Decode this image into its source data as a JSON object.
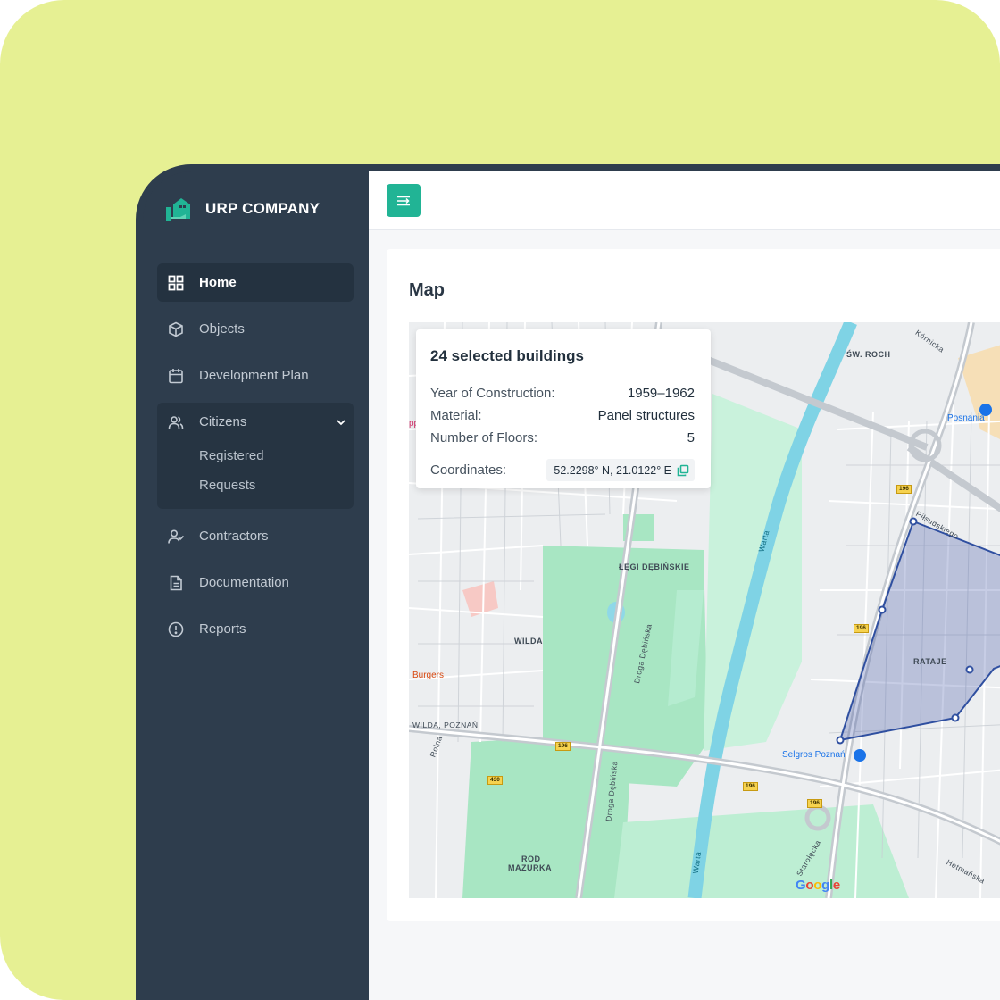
{
  "brand": {
    "name": "URP COMPANY",
    "icon": "house-hand-icon",
    "accent": "#21b495"
  },
  "sidebar": {
    "items": [
      {
        "label": "Home",
        "icon": "grid-icon",
        "active": true
      },
      {
        "label": "Objects",
        "icon": "cube-icon"
      },
      {
        "label": "Development Plan",
        "icon": "calendar-icon"
      },
      {
        "label": "Citizens",
        "icon": "users-icon",
        "expanded": true,
        "children": [
          "Registered",
          "Requests"
        ]
      },
      {
        "label": "Contractors",
        "icon": "user-check-icon"
      },
      {
        "label": "Documentation",
        "icon": "document-icon"
      },
      {
        "label": "Reports",
        "icon": "alert-circle-icon"
      }
    ]
  },
  "topbar": {
    "menu_icon": "menu-collapse-icon"
  },
  "page": {
    "title": "Map"
  },
  "popup": {
    "title": "24 selected buildings",
    "rows": [
      {
        "label": "Year of Construction:",
        "value": "1959–1962"
      },
      {
        "label": "Material:",
        "value": "Panel structures"
      },
      {
        "label": "Number of Floors:",
        "value": "5"
      }
    ],
    "coordinates_label": "Coordinates:",
    "coordinates_value": "52.2298° N, 21.0122° E"
  },
  "map": {
    "labels": {
      "sw_roch": "ŚW. ROCH",
      "legi": "ŁĘGI DĘBIŃSKIE",
      "wilda": "WILDA",
      "rataje": "RATAJE",
      "wilda_poznan": "WILDA, POZNAŃ",
      "rod": "ROD",
      "mazurka": "MAZURKA",
      "warta1": "Warta",
      "warta2": "Warta",
      "droga1": "Droga Dębińska",
      "droga2": "Droga Dębińska",
      "rolna": "Rolna",
      "pilsudskiego": "Piłsudskiego",
      "hetmanska": "Hetmańska",
      "starolecka": "Starołęcka",
      "kornicka": "Kórnicka"
    },
    "pois": {
      "posnania": "Posnania",
      "selgros": "Selgros Poznań",
      "burgers": "Burgers",
      "pp": "pp"
    },
    "road_numbers": [
      "196",
      "196",
      "196",
      "196",
      "196",
      "196",
      "430"
    ],
    "provider": "Google"
  }
}
